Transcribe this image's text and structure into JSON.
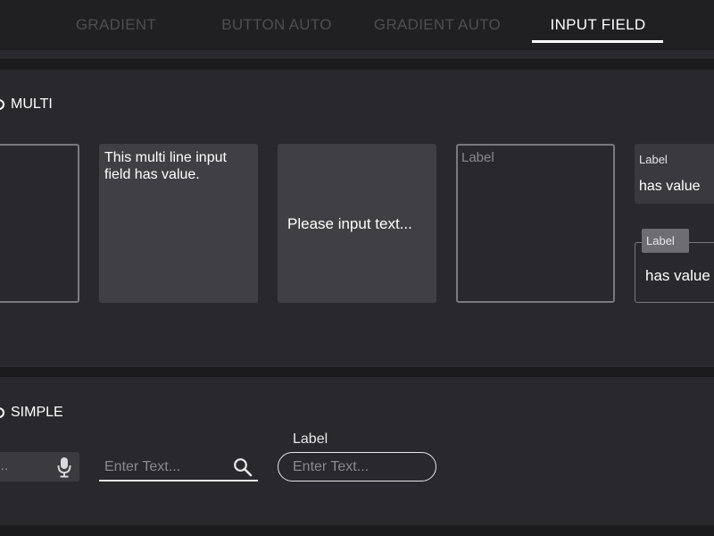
{
  "tabs": [
    {
      "label": "GRADIENT",
      "active": false
    },
    {
      "label": "BUTTON AUTO",
      "active": false
    },
    {
      "label": "GRADIENT AUTO",
      "active": false
    },
    {
      "label": "INPUT FIELD",
      "active": true
    }
  ],
  "multi": {
    "title": "MULTI",
    "fields": {
      "outline_empty": {
        "value": ""
      },
      "filled_value": {
        "value": "This multi line input field has value."
      },
      "filled_placeholder": {
        "placeholder": "Please input text..."
      },
      "outline_label": {
        "label": "Label"
      },
      "label_filled": {
        "label": "Label",
        "value": "has value"
      },
      "label_outline": {
        "label": "Label",
        "value": "has value"
      }
    }
  },
  "simple": {
    "title": "SIMPLE",
    "fields": {
      "voice": {
        "placeholder": "..."
      },
      "search": {
        "placeholder": "Enter Text..."
      },
      "rounded": {
        "label": "Label",
        "placeholder": "Enter Text..."
      }
    }
  },
  "colors": {
    "background": "#1b1b1d",
    "panel": "#29292d",
    "filled_field": "#404044",
    "outline": "#7a7a7e",
    "text": "#ffffff",
    "muted_text": "#8a8a8e",
    "inactive_tab": "#4e4e53"
  },
  "icons": {
    "voice": "microphone-icon",
    "search": "magnifier-icon"
  }
}
